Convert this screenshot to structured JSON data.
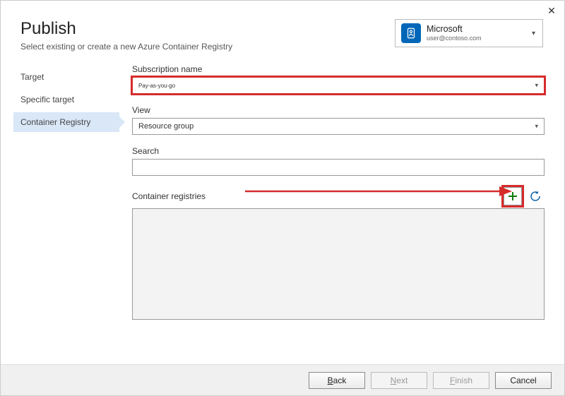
{
  "window": {
    "title": "Publish",
    "subtitle": "Select existing or create a new Azure Container Registry"
  },
  "account": {
    "name": "Microsoft",
    "email": "user@contoso.com"
  },
  "nav": {
    "items": [
      {
        "label": "Target"
      },
      {
        "label": "Specific target"
      },
      {
        "label": "Container Registry"
      }
    ]
  },
  "form": {
    "subscription_label": "Subscription name",
    "subscription_value": "Pay-as-you-go",
    "view_label": "View",
    "view_value": "Resource group",
    "search_label": "Search",
    "search_value": "",
    "registries_label": "Container registries"
  },
  "footer": {
    "back": "Back",
    "next": "Next",
    "finish": "Finish",
    "cancel": "Cancel"
  }
}
